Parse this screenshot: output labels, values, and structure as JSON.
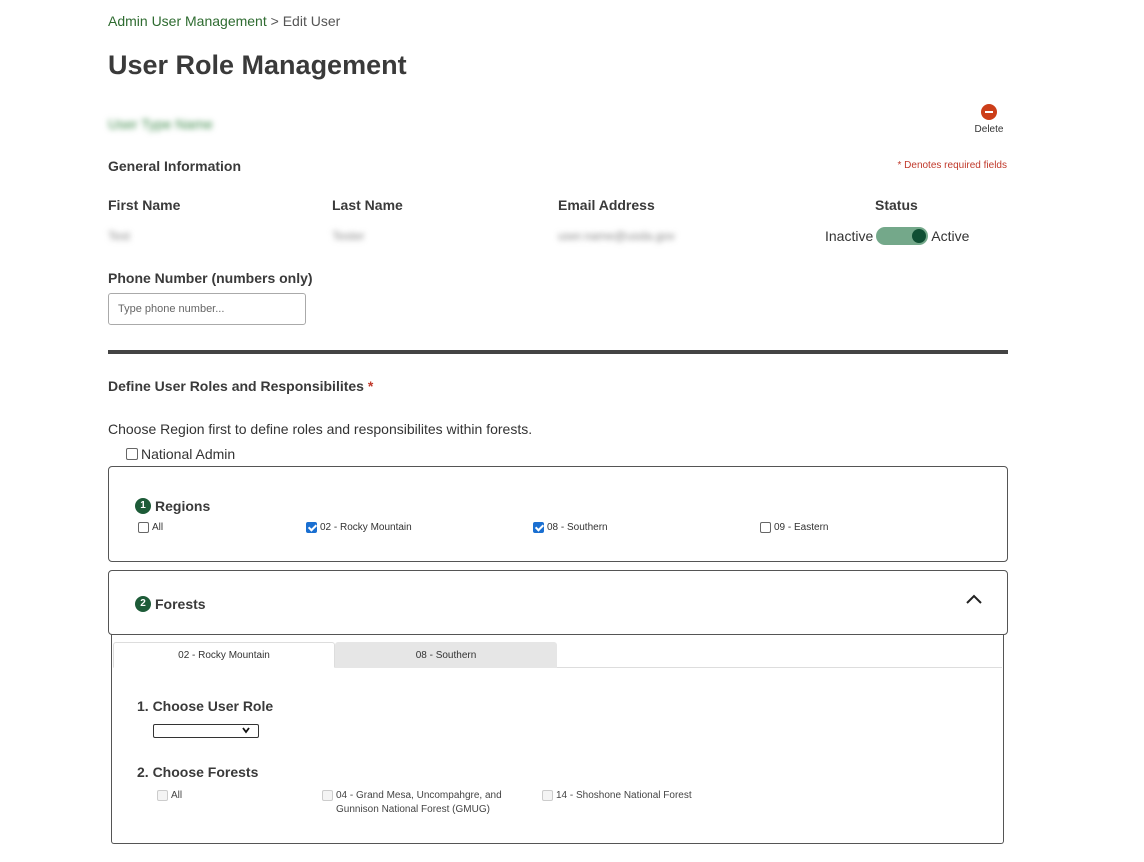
{
  "breadcrumb": {
    "parent": "Admin User Management",
    "separator": " > ",
    "current": "Edit User"
  },
  "page": {
    "title": "User Role Management",
    "user_name_blurred": "User Type Name",
    "delete_label": "Delete"
  },
  "general": {
    "heading": "General Information",
    "required_note": "* Denotes required fields",
    "first_name_label": "First Name",
    "first_name_value": "Test",
    "last_name_label": "Last Name",
    "last_name_value": "Tester",
    "email_label": "Email Address",
    "email_value": "user.name@usda.gov",
    "status_label": "Status",
    "status_inactive": "Inactive",
    "status_active": "Active",
    "status_on": true,
    "phone_label": "Phone Number (numbers only)",
    "phone_placeholder": "Type phone number...",
    "phone_value": ""
  },
  "roles": {
    "heading": "Define User Roles and Responsibilites",
    "required_mark": "*",
    "description": "Choose Region first to define roles and responsibilites within forests.",
    "national_admin_label": "National Admin",
    "national_admin_checked": false
  },
  "regions": {
    "step": "1",
    "title": "Regions",
    "options": [
      {
        "label": "All",
        "checked": false
      },
      {
        "label": "02 - Rocky Mountain",
        "checked": true
      },
      {
        "label": "08 - Southern",
        "checked": true
      },
      {
        "label": "09 - Eastern",
        "checked": false
      }
    ]
  },
  "forests": {
    "step": "2",
    "title": "Forests",
    "expanded": true,
    "tabs": [
      {
        "label": "02 - Rocky Mountain",
        "active": true
      },
      {
        "label": "08 - Southern",
        "active": false
      }
    ],
    "choose_role_heading": "1. Choose User Role",
    "selected_role": "",
    "choose_forests_heading": "2. Choose Forests",
    "forest_options": [
      {
        "label": "All",
        "checked": false,
        "disabled": true
      },
      {
        "label_line1": "04 - Grand Mesa, Uncompahgre, and",
        "label_line2": "Gunnison National Forest (GMUG)",
        "checked": false,
        "disabled": true
      },
      {
        "label": "14 - Shoshone National Forest",
        "checked": false,
        "disabled": true
      }
    ]
  },
  "colors": {
    "link_green": "#2e6b30",
    "badge_green": "#1d5b38",
    "toggle_track": "#74a88a",
    "delete_red": "#cc3e19",
    "required_red": "#c0392b",
    "checkbox_blue": "#1a6fd1"
  }
}
